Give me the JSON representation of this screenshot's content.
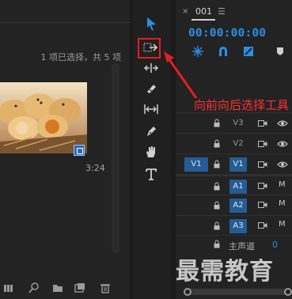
{
  "project_panel": {
    "selection_info": "1 项已选择，共 5 项",
    "clip_duration": "3:24",
    "bottom_icons": [
      "list-view-icon",
      "search-icon",
      "new-bin-icon",
      "new-item-icon",
      "trash-icon"
    ]
  },
  "tools": [
    "selection-tool",
    "track-select-forward-tool",
    "ripple-edit-tool",
    "razor-tool",
    "slip-tool",
    "pen-tool",
    "hand-tool",
    "type-tool"
  ],
  "timeline": {
    "tab_close": "×",
    "tab_label": "001",
    "tab_menu": "☰",
    "timecode": "00:00:00:00",
    "tracks": [
      {
        "name": "V3",
        "source": ""
      },
      {
        "name": "V2",
        "source": ""
      },
      {
        "name": "V1",
        "source": "V1"
      },
      {
        "name": "A1",
        "source": ""
      },
      {
        "name": "A2",
        "source": ""
      },
      {
        "name": "A3",
        "source": ""
      }
    ],
    "mute_label": "M",
    "master": {
      "label": "主声道",
      "value": "0"
    }
  },
  "annotation": "向前向后选择工具",
  "watermark": "最需教育",
  "colors": {
    "accent": "#2b8fe8",
    "highlight": "#e02020",
    "track_active": "#245c93"
  }
}
